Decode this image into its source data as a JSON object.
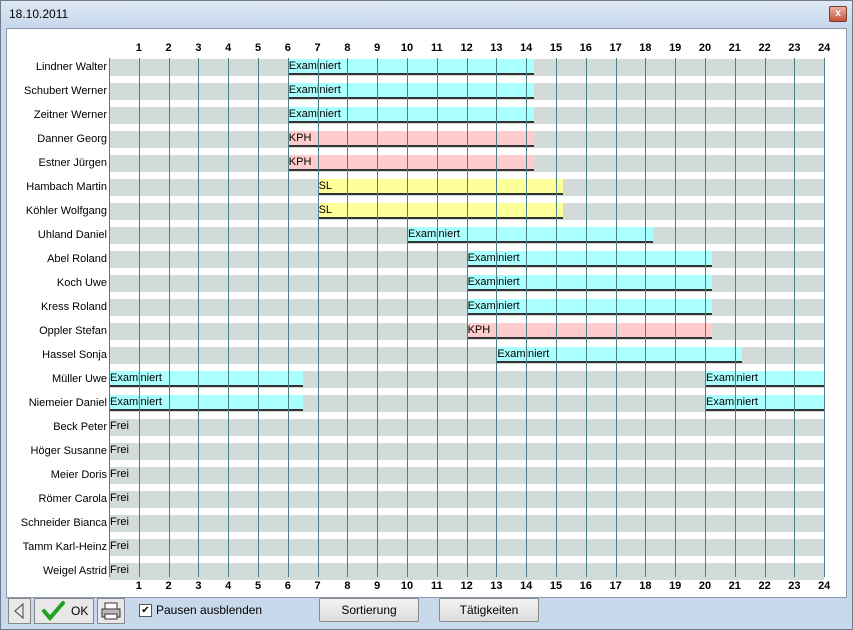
{
  "window": {
    "title": "18.10.2011",
    "close_label": "x"
  },
  "hours": [
    "1",
    "2",
    "3",
    "4",
    "5",
    "6",
    "7",
    "8",
    "9",
    "10",
    "11",
    "12",
    "13",
    "14",
    "15",
    "16",
    "17",
    "18",
    "19",
    "20",
    "21",
    "22",
    "23",
    "24"
  ],
  "rows": [
    {
      "name": "Lindner Walter",
      "bars": [
        {
          "label": "Examiniert",
          "start": 6,
          "end": 14.25,
          "color": "#aaffff"
        }
      ]
    },
    {
      "name": "Schubert Werner",
      "bars": [
        {
          "label": "Examiniert",
          "start": 6,
          "end": 14.25,
          "color": "#aaffff"
        }
      ]
    },
    {
      "name": "Zeitner Werner",
      "bars": [
        {
          "label": "Examiniert",
          "start": 6,
          "end": 14.25,
          "color": "#aaffff"
        }
      ]
    },
    {
      "name": "Danner Georg",
      "bars": [
        {
          "label": "KPH",
          "start": 6,
          "end": 14.25,
          "color": "#ffcccc"
        }
      ]
    },
    {
      "name": "Estner Jürgen",
      "bars": [
        {
          "label": "KPH",
          "start": 6,
          "end": 14.25,
          "color": "#ffcccc"
        }
      ]
    },
    {
      "name": "Hambach Martin",
      "bars": [
        {
          "label": "SL",
          "start": 7,
          "end": 15.25,
          "color": "#ffff99"
        }
      ]
    },
    {
      "name": "Köhler Wolfgang",
      "bars": [
        {
          "label": "SL",
          "start": 7,
          "end": 15.25,
          "color": "#ffff99"
        }
      ]
    },
    {
      "name": "Uhland Daniel",
      "bars": [
        {
          "label": "Examiniert",
          "start": 10,
          "end": 18.25,
          "color": "#aaffff"
        }
      ]
    },
    {
      "name": "Abel Roland",
      "bars": [
        {
          "label": "Examiniert",
          "start": 12,
          "end": 20.25,
          "color": "#aaffff"
        }
      ]
    },
    {
      "name": "Koch Uwe",
      "bars": [
        {
          "label": "Examiniert",
          "start": 12,
          "end": 20.25,
          "color": "#aaffff"
        }
      ]
    },
    {
      "name": "Kress Roland",
      "bars": [
        {
          "label": "Examiniert",
          "start": 12,
          "end": 20.25,
          "color": "#aaffff"
        }
      ]
    },
    {
      "name": "Oppler Stefan",
      "bars": [
        {
          "label": "KPH",
          "start": 12,
          "end": 20.25,
          "color": "#ffcccc"
        }
      ]
    },
    {
      "name": "Hassel Sonja",
      "bars": [
        {
          "label": "Examiniert",
          "start": 13,
          "end": 21.25,
          "color": "#aaffff"
        }
      ]
    },
    {
      "name": "Müller Uwe",
      "bars": [
        {
          "label": "Examiniert",
          "start": 0,
          "end": 6.5,
          "color": "#aaffff"
        },
        {
          "label": "Examiniert",
          "start": 20,
          "end": 24,
          "color": "#aaffff"
        }
      ]
    },
    {
      "name": "Niemeier Daniel",
      "bars": [
        {
          "label": "Examiniert",
          "start": 0,
          "end": 6.5,
          "color": "#aaffff"
        },
        {
          "label": "Examiniert",
          "start": 20,
          "end": 24,
          "color": "#aaffff"
        }
      ]
    },
    {
      "name": "Beck Peter",
      "bars": [
        {
          "label": "Frei",
          "start": 0,
          "end": 1,
          "color": "#d3dbd8"
        }
      ]
    },
    {
      "name": "Höger Susanne",
      "bars": [
        {
          "label": "Frei",
          "start": 0,
          "end": 1,
          "color": "#d3dbd8"
        }
      ]
    },
    {
      "name": "Meier Doris",
      "bars": [
        {
          "label": "Frei",
          "start": 0,
          "end": 1,
          "color": "#d3dbd8"
        }
      ]
    },
    {
      "name": "Römer Carola",
      "bars": [
        {
          "label": "Frei",
          "start": 0,
          "end": 1,
          "color": "#d3dbd8"
        }
      ]
    },
    {
      "name": "Schneider Bianca",
      "bars": [
        {
          "label": "Frei",
          "start": 0,
          "end": 1,
          "color": "#d3dbd8"
        }
      ]
    },
    {
      "name": "Tamm Karl-Heinz",
      "bars": [
        {
          "label": "Frei",
          "start": 0,
          "end": 1,
          "color": "#d3dbd8"
        }
      ]
    },
    {
      "name": "Weigel Astrid",
      "bars": [
        {
          "label": "Frei",
          "start": 0,
          "end": 1,
          "color": "#d3dbd8"
        }
      ]
    }
  ],
  "footer": {
    "ok_label": "OK",
    "checkbox_checked": true,
    "checkbox_mark": "✔",
    "checkbox_label": "Pausen ausblenden",
    "sort_button": "Sortierung",
    "tasks_button": "Tätigkeiten",
    "back_icon": "triangle-left-icon",
    "ok_icon": "green-check-icon",
    "print_icon": "printer-icon"
  }
}
